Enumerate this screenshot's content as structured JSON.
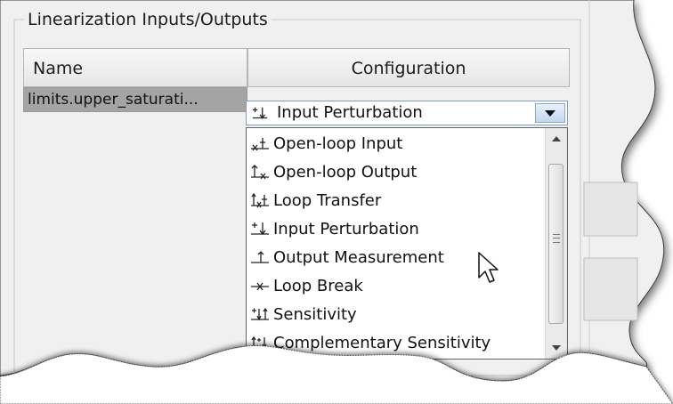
{
  "panel": {
    "title": "Linearization Inputs/Outputs"
  },
  "table": {
    "headers": {
      "name": "Name",
      "configuration": "Configuration"
    },
    "rows": [
      {
        "name": "limits.upper_saturati...",
        "configuration": "Input Perturbation"
      }
    ]
  },
  "combo": {
    "selected": "Input Perturbation",
    "icon": "input-perturbation-icon"
  },
  "dropdown": {
    "options": [
      {
        "label": "Open-loop Input",
        "icon": "open-loop-input-icon"
      },
      {
        "label": "Open-loop Output",
        "icon": "open-loop-output-icon"
      },
      {
        "label": "Loop Transfer",
        "icon": "loop-transfer-icon"
      },
      {
        "label": "Input Perturbation",
        "icon": "input-perturbation-icon"
      },
      {
        "label": "Output Measurement",
        "icon": "output-measurement-icon"
      },
      {
        "label": "Loop Break",
        "icon": "loop-break-icon"
      },
      {
        "label": "Sensitivity",
        "icon": "sensitivity-icon"
      },
      {
        "label": "Complementary Sensitivity",
        "icon": "complementary-sensitivity-icon"
      }
    ]
  },
  "colors": {
    "window_bg": "#f0f0f0",
    "selected_row": "#a4a4a4",
    "combo_border": "#7a9cc6",
    "list_border": "#646464"
  }
}
